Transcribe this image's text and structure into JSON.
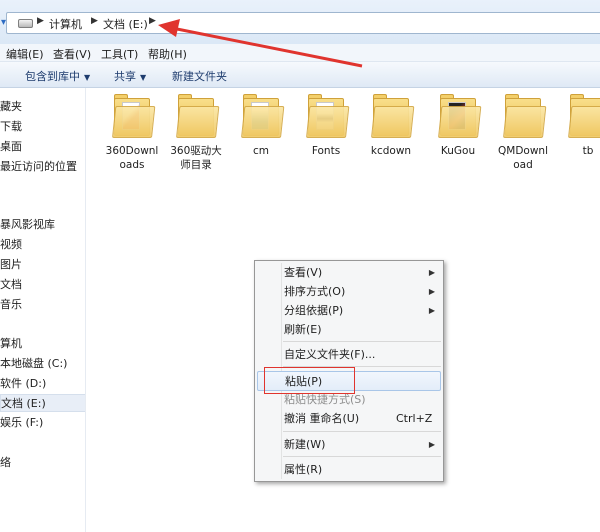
{
  "address": {
    "crumbs": [
      "计算机",
      "文档 (E:)"
    ]
  },
  "menu": {
    "items": [
      "编辑(E)",
      "查看(V)",
      "工具(T)",
      "帮助(H)"
    ]
  },
  "commands": {
    "include_library": "包含到库中",
    "share": "共享",
    "new_folder": "新建文件夹"
  },
  "nav": {
    "items": [
      "藏夹",
      "下载",
      "桌面",
      "最近访问的位置",
      "暴风影视库",
      "视频",
      "图片",
      "文档",
      "音乐",
      "算机",
      "本地磁盘 (C:)",
      "软件 (D:)",
      "文档 (E:)",
      "娱乐 (F:)",
      "络"
    ],
    "selected": "文档 (E:)"
  },
  "folders": [
    {
      "line1": "360Downl",
      "line2": "oads"
    },
    {
      "line1": "360驱动大",
      "line2": "师目录"
    },
    {
      "line1": "cm",
      "line2": ""
    },
    {
      "line1": "Fonts",
      "line2": ""
    },
    {
      "line1": "kcdown",
      "line2": ""
    },
    {
      "line1": "KuGou",
      "line2": ""
    },
    {
      "line1": "QMDownl",
      "line2": "oad"
    },
    {
      "line1": "tb",
      "line2": ""
    }
  ],
  "context_menu": {
    "view": "查看(V)",
    "sort": "排序方式(O)",
    "group": "分组依据(P)",
    "refresh": "刷新(E)",
    "customize": "自定义文件夹(F)...",
    "paste": "粘贴(P)",
    "paste_shortcut": "粘贴快捷方式(S)",
    "undo": "撤消 重命名(U)",
    "undo_shortcut": "Ctrl+Z",
    "new": "新建(W)",
    "properties": "属性(R)"
  },
  "colors": {
    "annotation": "#e0342e",
    "folder": "#f0c963",
    "selection": "#e8eef7"
  }
}
